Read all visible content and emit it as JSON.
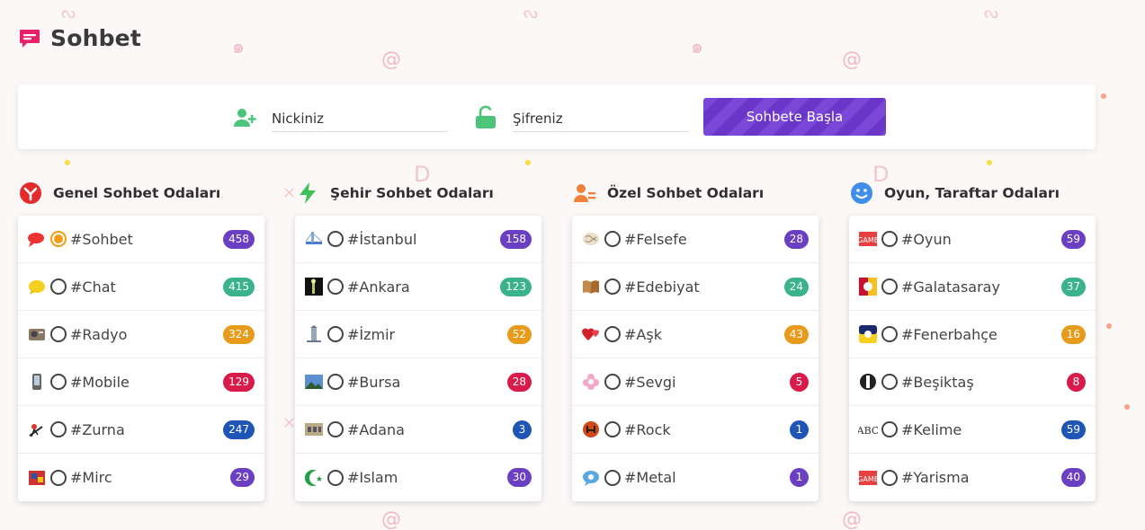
{
  "header": {
    "title": "Sohbet",
    "icon": "chat-bubble-icon",
    "icon_color": "#e8216b"
  },
  "login": {
    "nick_placeholder": "Nickiniz",
    "pass_placeholder": "Şifreniz",
    "start_label": "Sohbete Başla",
    "accent": "#7343d0"
  },
  "badge_colors": {
    "purple": "#6a3fc4",
    "green": "#3ab38a",
    "orange": "#e89a1a",
    "red": "#d81b4a",
    "blue": "#1f55b6"
  },
  "categories": [
    {
      "title": "Genel Sohbet Odaları",
      "icon": "generic-chat-icon",
      "rooms": [
        {
          "name": "#Sohbet",
          "count": "458",
          "color": "#6a3fc4",
          "icon": "speech-bubble-icon",
          "selected": true
        },
        {
          "name": "#Chat",
          "count": "415",
          "color": "#3ab38a",
          "icon": "yellow-bubble-icon"
        },
        {
          "name": "#Radyo",
          "count": "324",
          "color": "#e89a1a",
          "icon": "radio-icon"
        },
        {
          "name": "#Mobile",
          "count": "129",
          "color": "#d81b4a",
          "icon": "phone-icon"
        },
        {
          "name": "#Zurna",
          "count": "247",
          "color": "#1f55b6",
          "icon": "zurna-player-icon"
        },
        {
          "name": "#Mirc",
          "count": "29",
          "color": "#6a3fc4",
          "icon": "mirc-icon"
        }
      ]
    },
    {
      "title": "Şehir Sohbet Odaları",
      "icon": "lightning-icon",
      "rooms": [
        {
          "name": "#İstanbul",
          "count": "158",
          "color": "#6a3fc4",
          "icon": "bridge-icon"
        },
        {
          "name": "#Ankara",
          "count": "123",
          "color": "#3ab38a",
          "icon": "tower-icon"
        },
        {
          "name": "#İzmir",
          "count": "52",
          "color": "#e89a1a",
          "icon": "clock-tower-icon"
        },
        {
          "name": "#Bursa",
          "count": "28",
          "color": "#d81b4a",
          "icon": "landscape-icon"
        },
        {
          "name": "#Adana",
          "count": "3",
          "color": "#1f55b6",
          "icon": "building-icon"
        },
        {
          "name": "#Islam",
          "count": "30",
          "color": "#6a3fc4",
          "icon": "crescent-star-icon"
        }
      ]
    },
    {
      "title": "Özel Sohbet Odaları",
      "icon": "user-list-icon",
      "rooms": [
        {
          "name": "#Felsefe",
          "count": "28",
          "color": "#6a3fc4",
          "icon": "brain-icon"
        },
        {
          "name": "#Edebiyat",
          "count": "24",
          "color": "#3ab38a",
          "icon": "book-icon"
        },
        {
          "name": "#Aşk",
          "count": "43",
          "color": "#e89a1a",
          "icon": "hearts-icon"
        },
        {
          "name": "#Sevgi",
          "count": "5",
          "color": "#d81b4a",
          "icon": "flower-icon"
        },
        {
          "name": "#Rock",
          "count": "1",
          "color": "#1f55b6",
          "icon": "rock-hand-icon"
        },
        {
          "name": "#Metal",
          "count": "1",
          "color": "#6a3fc4",
          "icon": "metal-bubble-icon"
        }
      ]
    },
    {
      "title": "Oyun, Taraftar Odaları",
      "icon": "smiley-icon",
      "rooms": [
        {
          "name": "#Oyun",
          "count": "59",
          "color": "#6a3fc4",
          "icon": "game-icon"
        },
        {
          "name": "#Galatasaray",
          "count": "37",
          "color": "#3ab38a",
          "icon": "galatasaray-logo-icon"
        },
        {
          "name": "#Fenerbahçe",
          "count": "16",
          "color": "#e89a1a",
          "icon": "fenerbahce-logo-icon"
        },
        {
          "name": "#Beşiktaş",
          "count": "8",
          "color": "#d81b4a",
          "icon": "besiktas-logo-icon"
        },
        {
          "name": "#Kelime",
          "count": "59",
          "color": "#1f55b6",
          "icon": "abc-icon"
        },
        {
          "name": "#Yarisma",
          "count": "40",
          "color": "#6a3fc4",
          "icon": "game-icon"
        }
      ]
    }
  ]
}
